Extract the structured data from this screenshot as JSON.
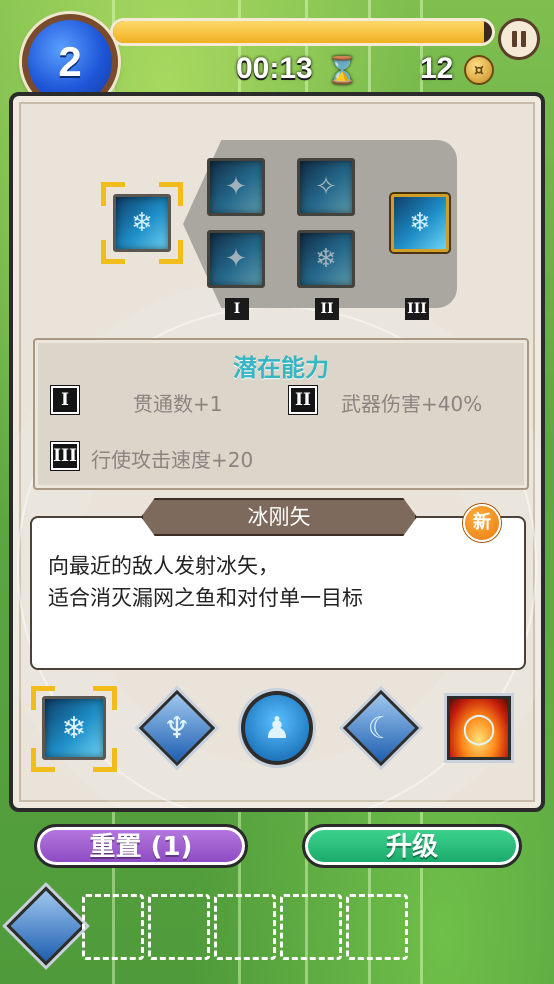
{
  "hud": {
    "level": "2",
    "xp_progress": 0.98,
    "timer": "00:13",
    "coins": "12",
    "hourglass_icon": "hourglass-icon",
    "coin_icon": "coin-icon",
    "pause_icon": "pause-icon"
  },
  "evolution": {
    "tier_labels": [
      "I",
      "II",
      "III"
    ]
  },
  "potential": {
    "title": "潜在能力",
    "items": [
      {
        "badge": "I",
        "text": "贯通数+1"
      },
      {
        "badge": "II",
        "text": "武器伤害+40%"
      },
      {
        "badge": "III",
        "text": "行使攻击速度+20"
      }
    ]
  },
  "skill": {
    "name": "冰刚矢",
    "new_badge": "新",
    "description_line1": "向最近的敌人发射冰矢，",
    "description_line2": "适合消灭漏网之鱼和对付单一目标"
  },
  "buttons": {
    "reset": "重置 (1)",
    "upgrade": "升级"
  },
  "colors": {
    "potential_title": "#35b6c2",
    "reset_button": "#8a48c0",
    "upgrade_button": "#18a86a",
    "selection_frame": "#f2bd1a"
  }
}
